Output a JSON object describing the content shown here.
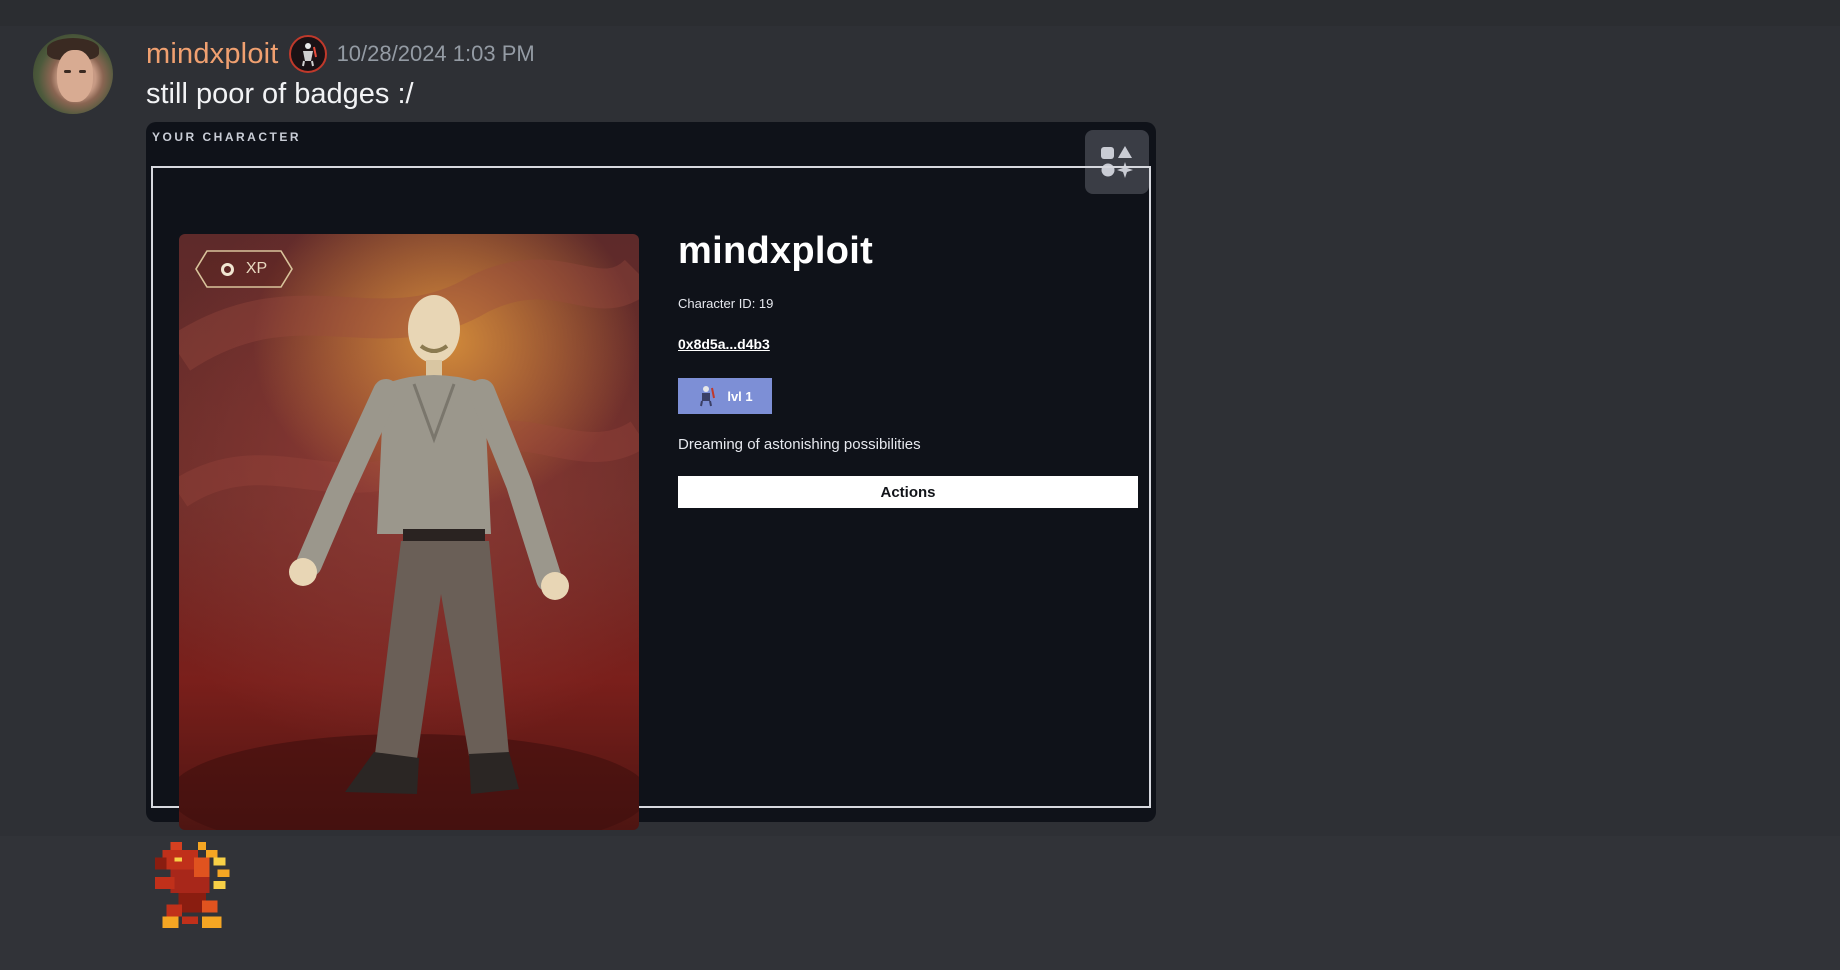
{
  "message": {
    "username": "mindxploit",
    "timestamp": "10/28/2024 1:03 PM",
    "text": "still poor of badges :/",
    "username_color": "#f0a070"
  },
  "embed": {
    "label": "YOUR CHARACTER",
    "card": {
      "xp_label": "XP",
      "name": "mindxploit",
      "character_id": "Character ID: 19",
      "wallet": "0x8d5a...d4b3",
      "level": "lvl 1",
      "status": "Dreaming of astonishing possibilities",
      "actions_label": "Actions"
    },
    "colors": {
      "level_chip": "#7d8fd6",
      "embed_bg": "#0f1219"
    }
  },
  "icons": {
    "app": "shapes-icon",
    "role": "character-role-icon",
    "sticker": "dragon-sticker"
  }
}
